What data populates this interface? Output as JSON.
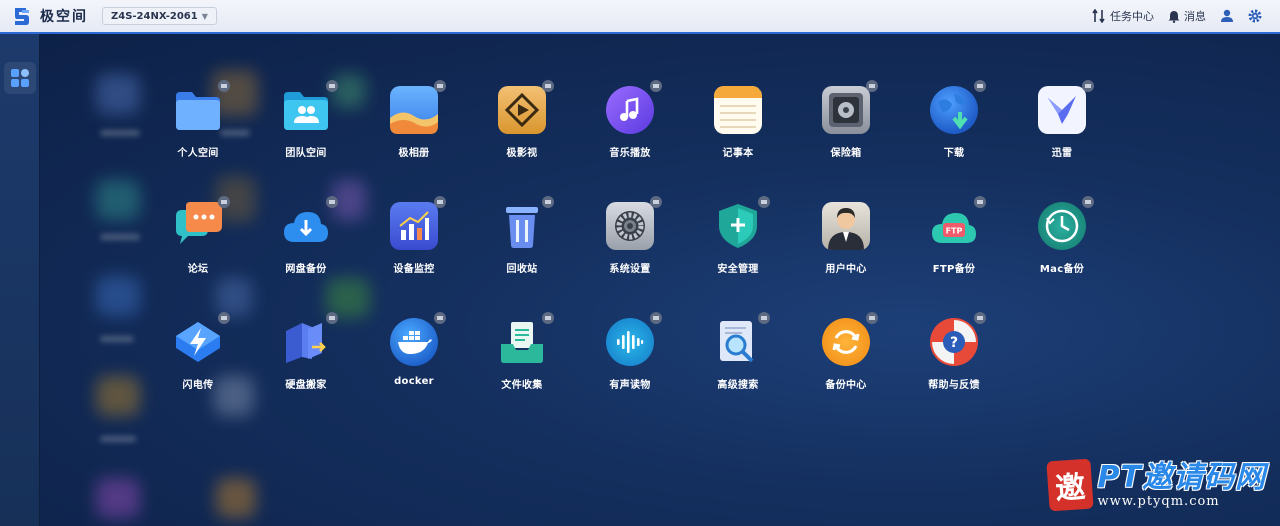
{
  "topbar": {
    "logo_text": "极空间",
    "device_name": "Z4S-24NX-2061",
    "task_center_label": "任务中心",
    "messages_label": "消息",
    "icons": [
      "task-center-icon",
      "bell-icon",
      "user-icon",
      "gear-icon"
    ]
  },
  "sidebar": {
    "items": [
      {
        "icon": "grid-apps-icon"
      }
    ]
  },
  "desktop": {
    "apps": [
      {
        "name": "personal-space",
        "label": "个人空间",
        "icon": "folder-icon"
      },
      {
        "name": "team-space",
        "label": "团队空间",
        "icon": "team-folder-icon"
      },
      {
        "name": "photo-album",
        "label": "极相册",
        "icon": "photo-icon"
      },
      {
        "name": "video",
        "label": "极影视",
        "icon": "film-icon"
      },
      {
        "name": "music",
        "label": "音乐播放",
        "icon": "music-note-icon"
      },
      {
        "name": "notepad",
        "label": "记事本",
        "icon": "notepad-icon"
      },
      {
        "name": "safe-box",
        "label": "保险箱",
        "icon": "safe-icon"
      },
      {
        "name": "download",
        "label": "下载",
        "icon": "globe-download-icon"
      },
      {
        "name": "xunlei",
        "label": "迅雷",
        "icon": "bird-icon"
      },
      {
        "name": "forum",
        "label": "论坛",
        "icon": "chat-bubble-icon"
      },
      {
        "name": "cloud-backup",
        "label": "网盘备份",
        "icon": "cloud-upload-icon"
      },
      {
        "name": "device-monitor",
        "label": "设备监控",
        "icon": "bar-chart-icon"
      },
      {
        "name": "recycle-bin",
        "label": "回收站",
        "icon": "trash-icon"
      },
      {
        "name": "system-settings",
        "label": "系统设置",
        "icon": "gear-settings-icon"
      },
      {
        "name": "security",
        "label": "安全管理",
        "icon": "shield-icon"
      },
      {
        "name": "user-center",
        "label": "用户中心",
        "icon": "user-avatar-icon"
      },
      {
        "name": "ftp-backup",
        "label": "FTP备份",
        "icon": "ftp-cloud-icon"
      },
      {
        "name": "mac-backup",
        "label": "Mac备份",
        "icon": "clock-icon"
      },
      {
        "name": "flash-transfer",
        "label": "闪电传",
        "icon": "lightning-icon"
      },
      {
        "name": "disk-move",
        "label": "硬盘搬家",
        "icon": "disk-transfer-icon"
      },
      {
        "name": "docker",
        "label": "docker",
        "icon": "docker-whale-icon"
      },
      {
        "name": "file-collect",
        "label": "文件收集",
        "icon": "file-tray-icon"
      },
      {
        "name": "audiobook",
        "label": "有声读物",
        "icon": "sound-wave-icon"
      },
      {
        "name": "advanced-search",
        "label": "高级搜索",
        "icon": "magnifier-icon"
      },
      {
        "name": "backup-center",
        "label": "备份中心",
        "icon": "sync-icon"
      },
      {
        "name": "help-feedback",
        "label": "帮助与反馈",
        "icon": "lifebuoy-icon"
      }
    ]
  },
  "watermark": {
    "seal_char": "邀",
    "main_text": "PT邀请码网",
    "url": "www.ptyqm.com"
  },
  "colors": {
    "accent": "#2c6ad6",
    "desktop_bg": "#142f5e",
    "sidebar_bg": "#1d3a6c"
  }
}
